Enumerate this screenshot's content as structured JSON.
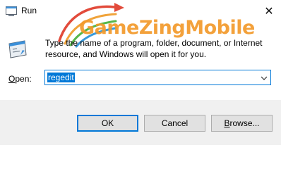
{
  "window": {
    "title": "Run"
  },
  "watermark": {
    "text": "GameZingMobile"
  },
  "dialog": {
    "description": "Type the name of a program, folder, document, or Internet resource, and Windows will open it for you.",
    "open_label_accel": "O",
    "open_label_rest": "pen:",
    "open_value": "regedit"
  },
  "buttons": {
    "ok": "OK",
    "cancel": "Cancel",
    "browse_accel": "B",
    "browse_rest": "rowse..."
  },
  "colors": {
    "accent": "#0078d7",
    "watermark_orange": "#f39a2b",
    "footer_bg": "#f0f0f0",
    "button_bg": "#e1e1e1"
  },
  "icons": [
    "run-app-icon",
    "close-icon",
    "run-dialog-icon",
    "dropdown-chevron-icon"
  ]
}
